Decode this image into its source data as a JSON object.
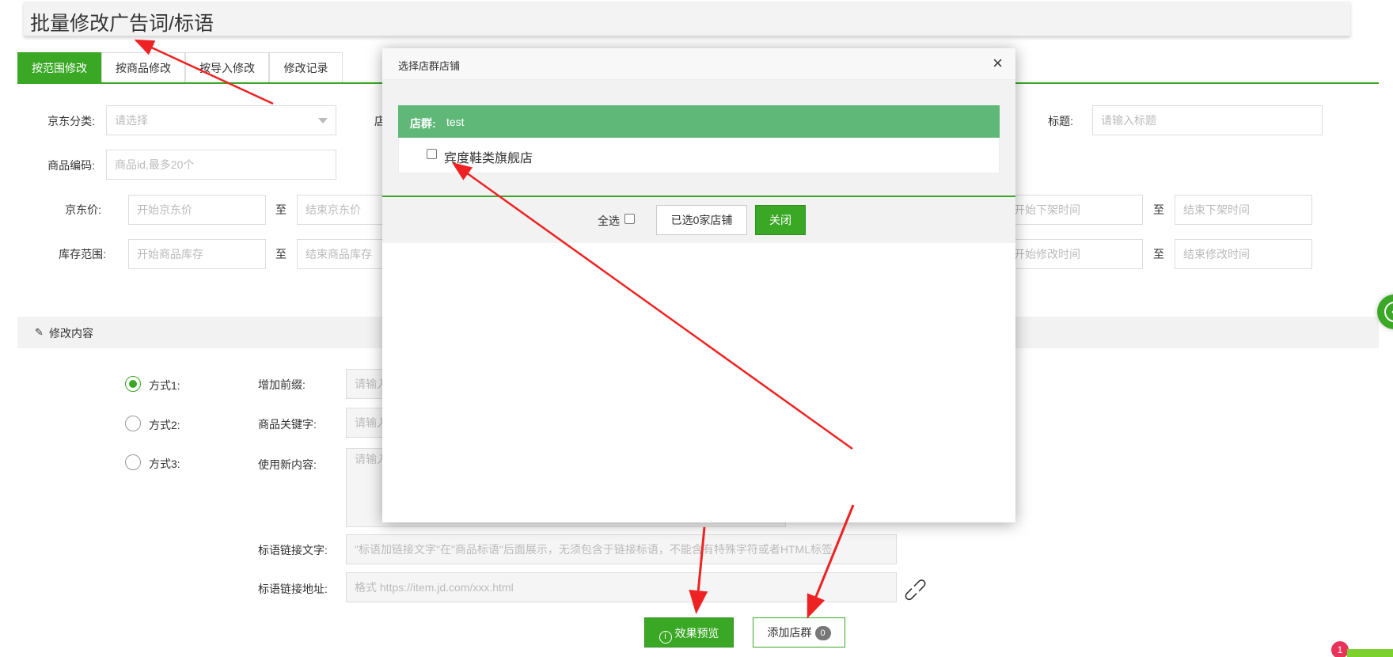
{
  "page_title": "批量修改广告词/标语",
  "tabs": [
    {
      "label": "按范围修改",
      "active": true
    },
    {
      "label": "按商品修改",
      "active": false
    },
    {
      "label": "按导入修改",
      "active": false
    },
    {
      "label": "修改记录",
      "active": false
    }
  ],
  "filters": {
    "category_label": "京东分类:",
    "category_placeholder": "请选择",
    "shop_label_partial": "店",
    "title_label": "标题:",
    "title_placeholder": "请输入标题",
    "code_label": "商品编码:",
    "code_placeholder": "商品id,最多20个",
    "price_label": "京东价:",
    "price_start_placeholder": "开始京东价",
    "price_end_placeholder": "结束京东价",
    "stock_label": "库存范围:",
    "stock_start_placeholder": "开始商品库存",
    "stock_end_placeholder": "结束商品库存",
    "offshelf_start_placeholder": "开始下架时间",
    "offshelf_end_placeholder": "结束下架时间",
    "modify_start_placeholder": "开始修改时间",
    "modify_end_placeholder": "结束修改时间",
    "to": "至"
  },
  "edit_section": {
    "title": "修改内容",
    "modes": [
      {
        "label": "方式1:",
        "selected": true
      },
      {
        "label": "方式2:",
        "selected": false
      },
      {
        "label": "方式3:",
        "selected": false
      }
    ],
    "prefix_label": "增加前缀:",
    "prefix_placeholder": "请输入",
    "keyword_label": "商品关键字:",
    "keyword_placeholder": "请输入",
    "new_content_label": "使用新内容:",
    "new_content_placeholder": "请输入",
    "slogan_link_text_label": "标语链接文字:",
    "slogan_link_text_placeholder": "\"标语加链接文字\"在\"商品标语\"后面展示，无须包含于链接标语，不能含有特殊字符或者HTML标签",
    "slogan_link_url_label": "标语链接地址:",
    "slogan_link_url_placeholder": "格式 https://item.jd.com/xxx.html"
  },
  "actions": {
    "preview_label": "效果预览",
    "add_group_label": "添加店群",
    "add_group_count": "0"
  },
  "notice_count": "1",
  "modal": {
    "title": "选择店群店铺",
    "group_label": "店群:",
    "group_name": "test",
    "shops": [
      {
        "name": "宾度鞋类旗舰店",
        "checked": false
      }
    ],
    "select_all_label": "全选",
    "selected_label": "已选0家店铺",
    "close_label": "关闭"
  },
  "colors": {
    "accent": "#3aa825",
    "group_header": "#5fb878",
    "annotation_arrow": "#ee2222"
  }
}
